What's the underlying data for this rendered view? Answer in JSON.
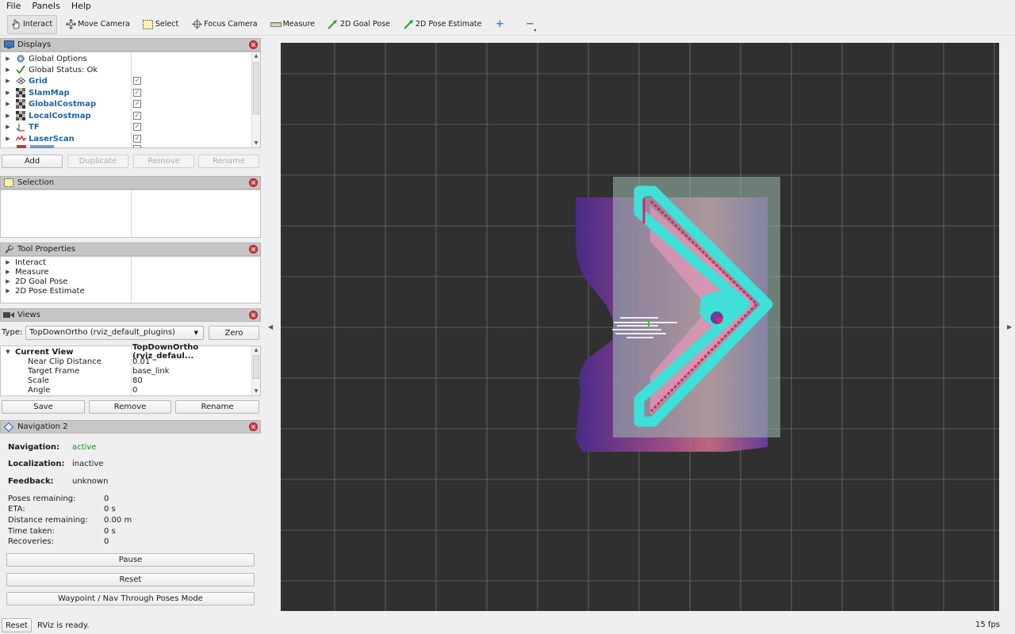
{
  "menubar": {
    "items": [
      "File",
      "Panels",
      "Help"
    ]
  },
  "toolbar": {
    "tools": [
      {
        "label": "Interact",
        "icon": "hand-pointer-icon"
      },
      {
        "label": "Move Camera",
        "icon": "move-camera-icon"
      },
      {
        "label": "Select",
        "icon": "select-box-icon"
      },
      {
        "label": "Focus Camera",
        "icon": "focus-crosshair-icon"
      },
      {
        "label": "Measure",
        "icon": "ruler-icon"
      },
      {
        "label": "2D Goal Pose",
        "icon": "green-arrow-icon"
      },
      {
        "label": "2D Pose Estimate",
        "icon": "green-arrow-icon"
      }
    ],
    "active_tool": "Interact",
    "add_tool_symbol": "+",
    "remove_tool_symbol": "−"
  },
  "displays": {
    "title": "Displays",
    "items": [
      {
        "label": "Global Options",
        "icon": "gear-icon",
        "checkable": false
      },
      {
        "label": "Global Status: Ok",
        "icon": "checkmark-icon",
        "checkable": false
      },
      {
        "label": "Grid",
        "icon": "grid-icon",
        "checkable": true,
        "checked": true
      },
      {
        "label": "SlamMap",
        "icon": "map-icon",
        "checkable": true,
        "checked": true
      },
      {
        "label": "GlobalCostmap",
        "icon": "map-icon",
        "checkable": true,
        "checked": true
      },
      {
        "label": "LocalCostmap",
        "icon": "map-icon",
        "checkable": true,
        "checked": true
      },
      {
        "label": "TF",
        "icon": "tf-axes-icon",
        "checkable": true,
        "checked": true
      },
      {
        "label": "LaserScan",
        "icon": "laser-scan-icon",
        "checkable": true,
        "checked": true
      }
    ],
    "buttons": {
      "add": "Add",
      "duplicate": "Duplicate",
      "remove": "Remove",
      "rename": "Rename"
    }
  },
  "selection": {
    "title": "Selection"
  },
  "tool_properties": {
    "title": "Tool Properties",
    "items": [
      "Interact",
      "Measure",
      "2D Goal Pose",
      "2D Pose Estimate"
    ]
  },
  "views": {
    "title": "Views",
    "type_label": "Type:",
    "type_value": "TopDownOrtho (rviz_default_plugins)",
    "zero_button": "Zero",
    "current_view": {
      "label": "Current View",
      "value": "TopDownOrtho (rviz_defaul...",
      "properties": [
        {
          "name": "Near Clip Distance",
          "value": "0.01"
        },
        {
          "name": "Target Frame",
          "value": "base_link"
        },
        {
          "name": "Scale",
          "value": "80"
        },
        {
          "name": "Angle",
          "value": "0"
        }
      ]
    },
    "buttons": {
      "save": "Save",
      "remove": "Remove",
      "rename": "Rename"
    }
  },
  "navigation": {
    "title": "Navigation 2",
    "navigation_label": "Navigation:",
    "navigation_value": "active",
    "localization_label": "Localization:",
    "localization_value": "inactive",
    "feedback_label": "Feedback:",
    "feedback_value": "unknown",
    "stats": [
      {
        "name": "Poses remaining:",
        "value": "0"
      },
      {
        "name": "ETA:",
        "value": "0 s"
      },
      {
        "name": "Distance remaining:",
        "value": "0.00 m"
      },
      {
        "name": "Time taken:",
        "value": "0 s"
      },
      {
        "name": "Recoveries:",
        "value": "0"
      }
    ],
    "buttons": {
      "pause": "Pause",
      "reset": "Reset",
      "waypoint": "Waypoint / Nav Through Poses Mode"
    },
    "colors": {
      "active": "#1a8c1a"
    }
  },
  "statusbar": {
    "reset_button": "Reset",
    "status": "RViz is ready.",
    "fps": "15 fps"
  },
  "viewport": {
    "colors": {
      "background": "#303030",
      "grid": "#a0a0a0",
      "costmap_cyan": "#3fe0d8",
      "lethal_red": "#e0245a",
      "inflation_purple": "#5a2f9a"
    }
  }
}
